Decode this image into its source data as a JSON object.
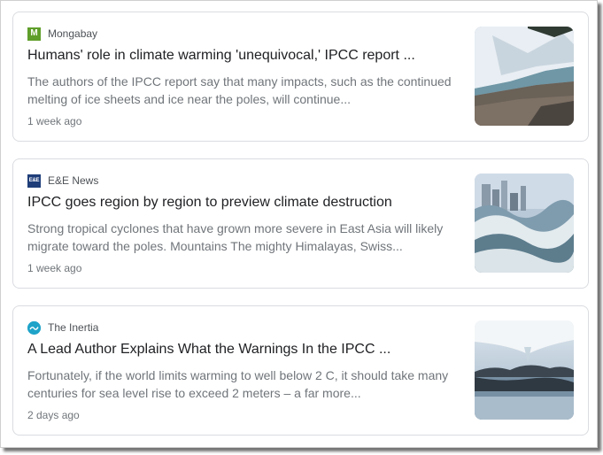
{
  "articles": [
    {
      "source": "Mongabay",
      "favicon_icon": "mongabay-favicon",
      "favicon_glyph": "M",
      "headline": "Humans' role in climate warming 'unequivocal,' IPCC report ...",
      "snippet": "The authors of the IPCC report say that many impacts, such as the continued melting of ice sheets and ice near the poles, will continue...",
      "age": "1 week ago",
      "thumbnail": "glacier-coast-image"
    },
    {
      "source": "E&E News",
      "favicon_icon": "ee-news-favicon",
      "favicon_glyph": "E&E",
      "headline": "IPCC goes region by region to preview climate destruction",
      "snippet": "Strong tropical cyclones that have grown more severe in East Asia will likely migrate toward the poles. Mountains The mighty Himalayas, Swiss...",
      "age": "1 week ago",
      "thumbnail": "city-storm-waves-image"
    },
    {
      "source": "The Inertia",
      "favicon_icon": "inertia-wave-favicon",
      "favicon_glyph": "",
      "headline": "A Lead Author Explains What the Warnings In the IPCC ...",
      "snippet": "Fortunately, if the world limits warming to well below 2 C, it should take many centuries for sea level rise to exceed 2 meters – a far more...",
      "age": "2 days ago",
      "thumbnail": "melting-ice-lake-image"
    }
  ]
}
